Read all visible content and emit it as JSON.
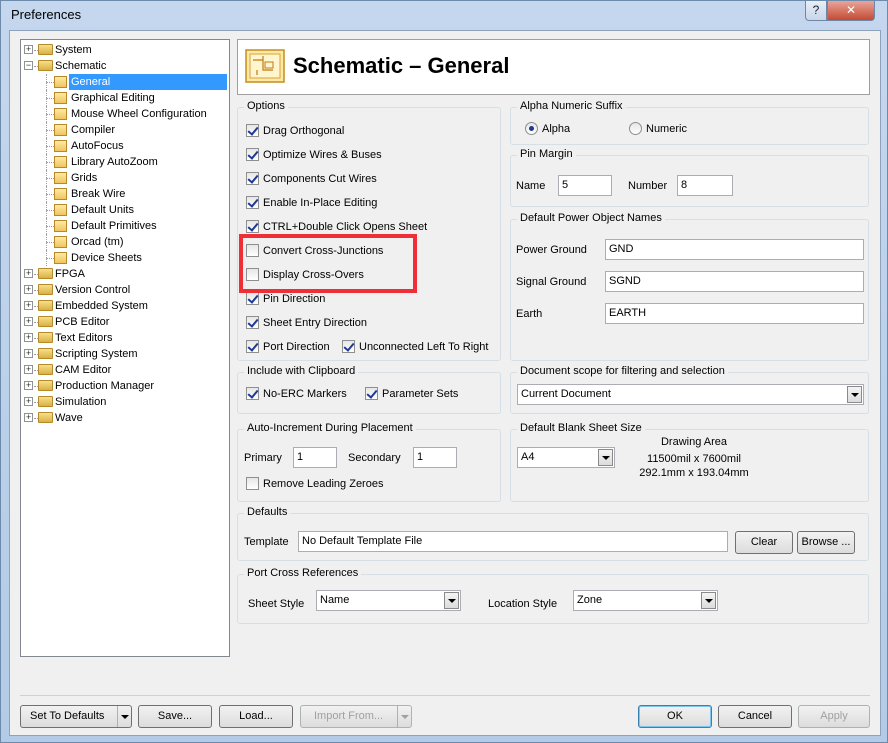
{
  "window": {
    "title": "Preferences",
    "help_btn": "?",
    "close_btn": "✕"
  },
  "tree": [
    {
      "label": "System",
      "level": 0,
      "expander": "+",
      "icon": "folder-icon"
    },
    {
      "label": "Schematic",
      "level": 0,
      "expander": "−",
      "icon": "folder-open-icon"
    },
    {
      "label": "General",
      "level": 1,
      "icon": "page-icon",
      "selected": true
    },
    {
      "label": "Graphical Editing",
      "level": 1,
      "icon": "page-icon"
    },
    {
      "label": "Mouse Wheel Configuration",
      "level": 1,
      "icon": "page-icon"
    },
    {
      "label": "Compiler",
      "level": 1,
      "icon": "page-icon"
    },
    {
      "label": "AutoFocus",
      "level": 1,
      "icon": "page-icon"
    },
    {
      "label": "Library AutoZoom",
      "level": 1,
      "icon": "page-icon"
    },
    {
      "label": "Grids",
      "level": 1,
      "icon": "page-icon"
    },
    {
      "label": "Break Wire",
      "level": 1,
      "icon": "page-icon"
    },
    {
      "label": "Default Units",
      "level": 1,
      "icon": "page-icon"
    },
    {
      "label": "Default Primitives",
      "level": 1,
      "icon": "page-icon"
    },
    {
      "label": "Orcad (tm)",
      "level": 1,
      "icon": "page-icon"
    },
    {
      "label": "Device Sheets",
      "level": 1,
      "icon": "page-icon"
    },
    {
      "label": "FPGA",
      "level": 0,
      "expander": "+",
      "icon": "folder-icon"
    },
    {
      "label": "Version Control",
      "level": 0,
      "expander": "+",
      "icon": "folder-icon"
    },
    {
      "label": "Embedded System",
      "level": 0,
      "expander": "+",
      "icon": "folder-icon"
    },
    {
      "label": "PCB Editor",
      "level": 0,
      "expander": "+",
      "icon": "folder-icon"
    },
    {
      "label": "Text Editors",
      "level": 0,
      "expander": "+",
      "icon": "folder-icon"
    },
    {
      "label": "Scripting System",
      "level": 0,
      "expander": "+",
      "icon": "folder-icon"
    },
    {
      "label": "CAM Editor",
      "level": 0,
      "expander": "+",
      "icon": "folder-icon"
    },
    {
      "label": "Production Manager",
      "level": 0,
      "expander": "+",
      "icon": "folder-icon"
    },
    {
      "label": "Simulation",
      "level": 0,
      "expander": "+",
      "icon": "folder-icon"
    },
    {
      "label": "Wave",
      "level": 0,
      "expander": "+",
      "icon": "folder-icon"
    }
  ],
  "header": {
    "title": "Schematic – General",
    "icon": "schematic-sheet-icon"
  },
  "options": {
    "title": "Options",
    "items": [
      {
        "label": "Drag Orthogonal",
        "checked": true
      },
      {
        "label": "Optimize Wires & Buses",
        "checked": true
      },
      {
        "label": "Components Cut Wires",
        "checked": true
      },
      {
        "label": "Enable In-Place Editing",
        "checked": true
      },
      {
        "label": "CTRL+Double Click Opens Sheet",
        "checked": true
      },
      {
        "label": "Convert Cross-Junctions",
        "checked": false
      },
      {
        "label": "Display Cross-Overs",
        "checked": false
      },
      {
        "label": "Pin Direction",
        "checked": true
      },
      {
        "label": "Sheet Entry Direction",
        "checked": true
      },
      {
        "label": "Port Direction",
        "checked": true
      }
    ],
    "extra": {
      "label": "Unconnected Left To Right",
      "checked": true
    }
  },
  "include_clipboard": {
    "title": "Include with Clipboard",
    "items": [
      {
        "label": "No-ERC Markers",
        "checked": true
      },
      {
        "label": "Parameter Sets",
        "checked": true
      }
    ]
  },
  "auto_increment": {
    "title": "Auto-Increment During Placement",
    "primary_label": "Primary",
    "primary_value": "1",
    "secondary_label": "Secondary",
    "secondary_value": "1",
    "remove_zeroes": {
      "label": "Remove Leading Zeroes",
      "checked": false
    }
  },
  "alpha_suffix": {
    "title": "Alpha Numeric Suffix",
    "alpha": "Alpha",
    "numeric": "Numeric",
    "selected": "Alpha"
  },
  "pin_margin": {
    "title": "Pin Margin",
    "name_label": "Name",
    "name_value": "5",
    "number_label": "Number",
    "number_value": "8"
  },
  "power_names": {
    "title": "Default Power Object Names",
    "power_label": "Power Ground",
    "power_value": "GND",
    "signal_label": "Signal Ground",
    "signal_value": "SGND",
    "earth_label": "Earth",
    "earth_value": "EARTH"
  },
  "doc_scope": {
    "title": "Document scope for filtering and selection",
    "value": "Current Document"
  },
  "blank_sheet": {
    "title": "Default Blank Sheet Size",
    "value": "A4",
    "drawing_area_label": "Drawing Area",
    "mil": "11500mil x 7600mil",
    "mm": "292.1mm x 193.04mm"
  },
  "defaults": {
    "title": "Defaults",
    "template_label": "Template",
    "template_value": "No Default Template File",
    "clear": "Clear",
    "browse": "Browse ..."
  },
  "port_cross": {
    "title": "Port Cross References",
    "sheet_style_label": "Sheet Style",
    "sheet_style_value": "Name",
    "location_style_label": "Location Style",
    "location_style_value": "Zone"
  },
  "footer": {
    "set_defaults": "Set To Defaults",
    "save": "Save...",
    "load": "Load...",
    "import_from": "Import From...",
    "ok": "OK",
    "cancel": "Cancel",
    "apply": "Apply"
  },
  "highlight_color": "#ef2f35"
}
